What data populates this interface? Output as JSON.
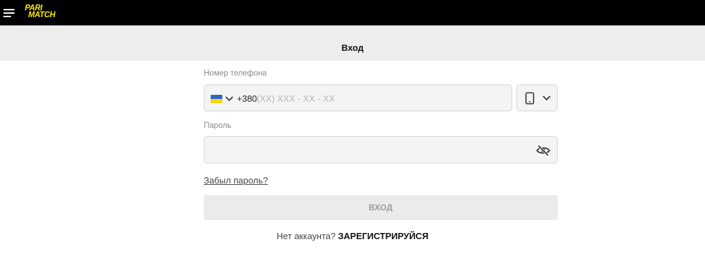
{
  "header": {
    "logo_line1": "PARI",
    "logo_line2": "MATCH",
    "logo_color": "#ffea00",
    "bar_color": "#000000"
  },
  "page": {
    "title": "Вход"
  },
  "phone": {
    "label": "Номер телефона",
    "country_flag": "ukraine-flag",
    "prefix": "+380",
    "placeholder": "(XX) XXX - XX - XX",
    "value": ""
  },
  "device_selector": {
    "icon": "smartphone-icon"
  },
  "password": {
    "label": "Пароль",
    "value": "",
    "toggle_icon": "eye-off-icon"
  },
  "links": {
    "forgot_password": "Забыл пароль?"
  },
  "login_button": {
    "label": "ВХОД"
  },
  "register": {
    "prompt": "Нет аккаунта?",
    "link": "ЗАРЕГИСТРИРУЙСЯ"
  }
}
